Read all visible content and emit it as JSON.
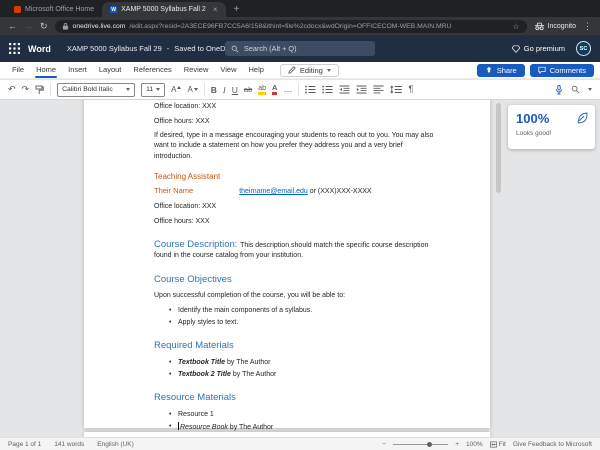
{
  "browser": {
    "tabs": [
      {
        "title": "Microsoft Office Home"
      },
      {
        "title": "XAMP 5000 Syllabus Fall 2"
      }
    ],
    "url": {
      "domain": "onedrive.live.com",
      "path": "/edit.aspx?resid=2A3ECE96FB7CC5A6!158&ithint=file%2cdocx&wdOrigin=OFFICECOM-WEB.MAIN.MRU"
    },
    "incognito_label": "Incognito"
  },
  "header": {
    "app_name": "Word",
    "doc_title": "XAMP 5000 Syllabus Fall 29",
    "separator": "-",
    "save_status": "Saved to OneDrive",
    "search_placeholder": "Search (Alt + Q)",
    "go_premium_label": "Go premium",
    "avatar_initials": "SC"
  },
  "ribbon": {
    "tabs": [
      "File",
      "Home",
      "Insert",
      "Layout",
      "References",
      "Review",
      "View",
      "Help"
    ],
    "active_tab": "Home",
    "editing_label": "Editing",
    "share_label": "Share",
    "comments_label": "Comments",
    "font_name": "Calibri Bold Italic",
    "font_size": "11"
  },
  "icons": {
    "back": "←",
    "forward": "→",
    "reload": "↻",
    "star": "☆",
    "kebab": "⋮",
    "close_tab": "×",
    "new_tab": "+",
    "word_favicon": "W",
    "undo": "↶",
    "redo": "↷",
    "bold": "B",
    "italic": "I",
    "underline": "U",
    "strikethrough": "ab",
    "highlight": "ab",
    "font_color": "A",
    "grow_font": "A",
    "shrink_font": "A",
    "more": "…",
    "paragraph_mark": "¶"
  },
  "document": {
    "blocks": [
      {
        "style": "body",
        "segments": [
          {
            "t": "Office location: XXX"
          }
        ]
      },
      {
        "style": "body",
        "segments": [
          {
            "t": "Office hours: XXX"
          }
        ]
      },
      {
        "style": "body",
        "segments": [
          {
            "t": "If desired, type in a message encouraging your students to reach out to you. You may also want to include a statement on how you prefer they address you and a very brief introduction."
          }
        ]
      },
      {
        "style": "h2o",
        "segments": [
          {
            "t": "Teaching Assistant"
          }
        ]
      },
      {
        "style": "body",
        "segments": [
          {
            "t": "Their Name",
            "c": "orange"
          },
          {
            "c": "tab"
          },
          {
            "t": "theirname@email.edu",
            "c": "link"
          },
          {
            "t": " or (XXX)XXX-XXXX"
          }
        ]
      },
      {
        "style": "body",
        "segments": [
          {
            "t": "Office location: XXX"
          }
        ]
      },
      {
        "style": "body",
        "segments": [
          {
            "t": "Office hours: XXX"
          }
        ]
      },
      {
        "style": "body h1lead",
        "segments": [
          {
            "t": "Course Description: ",
            "c": "h1s"
          },
          {
            "t": "This description should match the specific course description found in the course catalog from your institution."
          }
        ]
      },
      {
        "style": "h1",
        "segments": [
          {
            "t": "Course Objectives"
          }
        ]
      },
      {
        "style": "body",
        "segments": [
          {
            "t": "Upon successful completion of the course, you will be able to:"
          }
        ]
      },
      {
        "style": "bullet",
        "segments": [
          {
            "t": "Identify the main components of a syllabus."
          }
        ]
      },
      {
        "style": "bullet",
        "segments": [
          {
            "t": "Apply styles to text."
          }
        ]
      },
      {
        "style": "h1",
        "segments": [
          {
            "t": "Required Materials"
          }
        ]
      },
      {
        "style": "bullet",
        "segments": [
          {
            "t": "Textbook Title",
            "c": "bi"
          },
          {
            "t": " by The Author"
          }
        ]
      },
      {
        "style": "bullet",
        "segments": [
          {
            "t": "Textbook 2 Title",
            "c": "bi"
          },
          {
            "t": " by The Author"
          }
        ]
      },
      {
        "style": "h1",
        "segments": [
          {
            "t": "Resource Materials"
          }
        ]
      },
      {
        "style": "bullet",
        "segments": [
          {
            "t": "Resource 1"
          }
        ]
      },
      {
        "style": "bullet",
        "segments": [
          {
            "caret": true
          },
          {
            "t": "Resource Book",
            "c": "i"
          },
          {
            "t": " by The Author"
          }
        ]
      }
    ]
  },
  "editor_panel": {
    "score": "100%",
    "caption": "Looks good!"
  },
  "status_bar": {
    "page_count": "Page 1 of 1",
    "word_count": "141 words",
    "language": "English (UK)",
    "zoom_out": "−",
    "zoom_in": "+",
    "zoom_level": "100%",
    "fit_label": "Fit",
    "feedback_label": "Give Feedback to Microsoft"
  }
}
